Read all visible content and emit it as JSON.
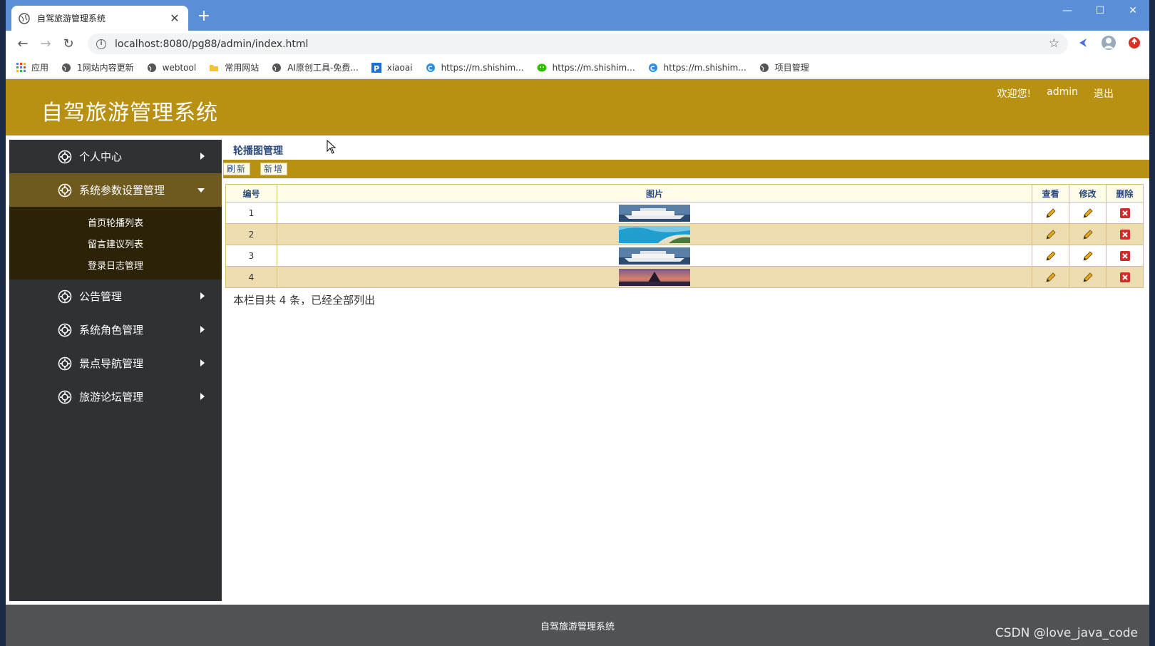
{
  "browser": {
    "tab_title": "自驾旅游管理系统",
    "url": "localhost:8080/pg88/admin/index.html",
    "bookmarks": [
      {
        "label": "应用",
        "icon": "apps-grid-icon"
      },
      {
        "label": "1网站内容更新",
        "icon": "globe-icon"
      },
      {
        "label": "webtool",
        "icon": "globe-icon"
      },
      {
        "label": "常用网站",
        "icon": "folder-icon"
      },
      {
        "label": "AI原创工具-免费...",
        "icon": "globe-icon"
      },
      {
        "label": "xiaoai",
        "icon": "p-logo-icon"
      },
      {
        "label": "https://m.shishim...",
        "icon": "c-logo-icon"
      },
      {
        "label": "https://m.shishim...",
        "icon": "wechat-icon"
      },
      {
        "label": "https://m.shishim...",
        "icon": "c-logo-icon"
      },
      {
        "label": "项目管理",
        "icon": "globe-icon"
      }
    ]
  },
  "header": {
    "title": "自驾旅游管理系统",
    "welcome": "欢迎您!",
    "username": "admin",
    "logout": "退出"
  },
  "sidebar": {
    "menus": [
      {
        "label": "个人中心",
        "open": false
      },
      {
        "label": "系统参数设置管理",
        "open": true,
        "children": [
          "首页轮播列表",
          "留言建议列表",
          "登录日志管理"
        ]
      },
      {
        "label": "公告管理",
        "open": false
      },
      {
        "label": "系统角色管理",
        "open": false
      },
      {
        "label": "景点导航管理",
        "open": false
      },
      {
        "label": "旅游论坛管理",
        "open": false
      }
    ]
  },
  "main": {
    "page_title": "轮播图管理",
    "toolbar": {
      "refresh": "刷新",
      "add": "新增"
    },
    "columns": [
      "编号",
      "图片",
      "查看",
      "修改",
      "删除"
    ],
    "rows": [
      {
        "id": "1",
        "image": "cruise-ship-thumbnail"
      },
      {
        "id": "2",
        "image": "coastline-thumbnail"
      },
      {
        "id": "3",
        "image": "cruise-ship-thumbnail"
      },
      {
        "id": "4",
        "image": "sunset-sea-thumbnail"
      }
    ],
    "summary": "本栏目共 4 条，已经全部列出"
  },
  "footer": {
    "text": "自驾旅游管理系统"
  },
  "watermark": "CSDN @love_java_code",
  "colors": {
    "accent": "#b89012",
    "sidebar": "#2f3135",
    "submenu": "#2c2208",
    "open_menu": "#6e5a1e",
    "alt_row": "#ecdcb0",
    "delete": "#d22b2b"
  }
}
